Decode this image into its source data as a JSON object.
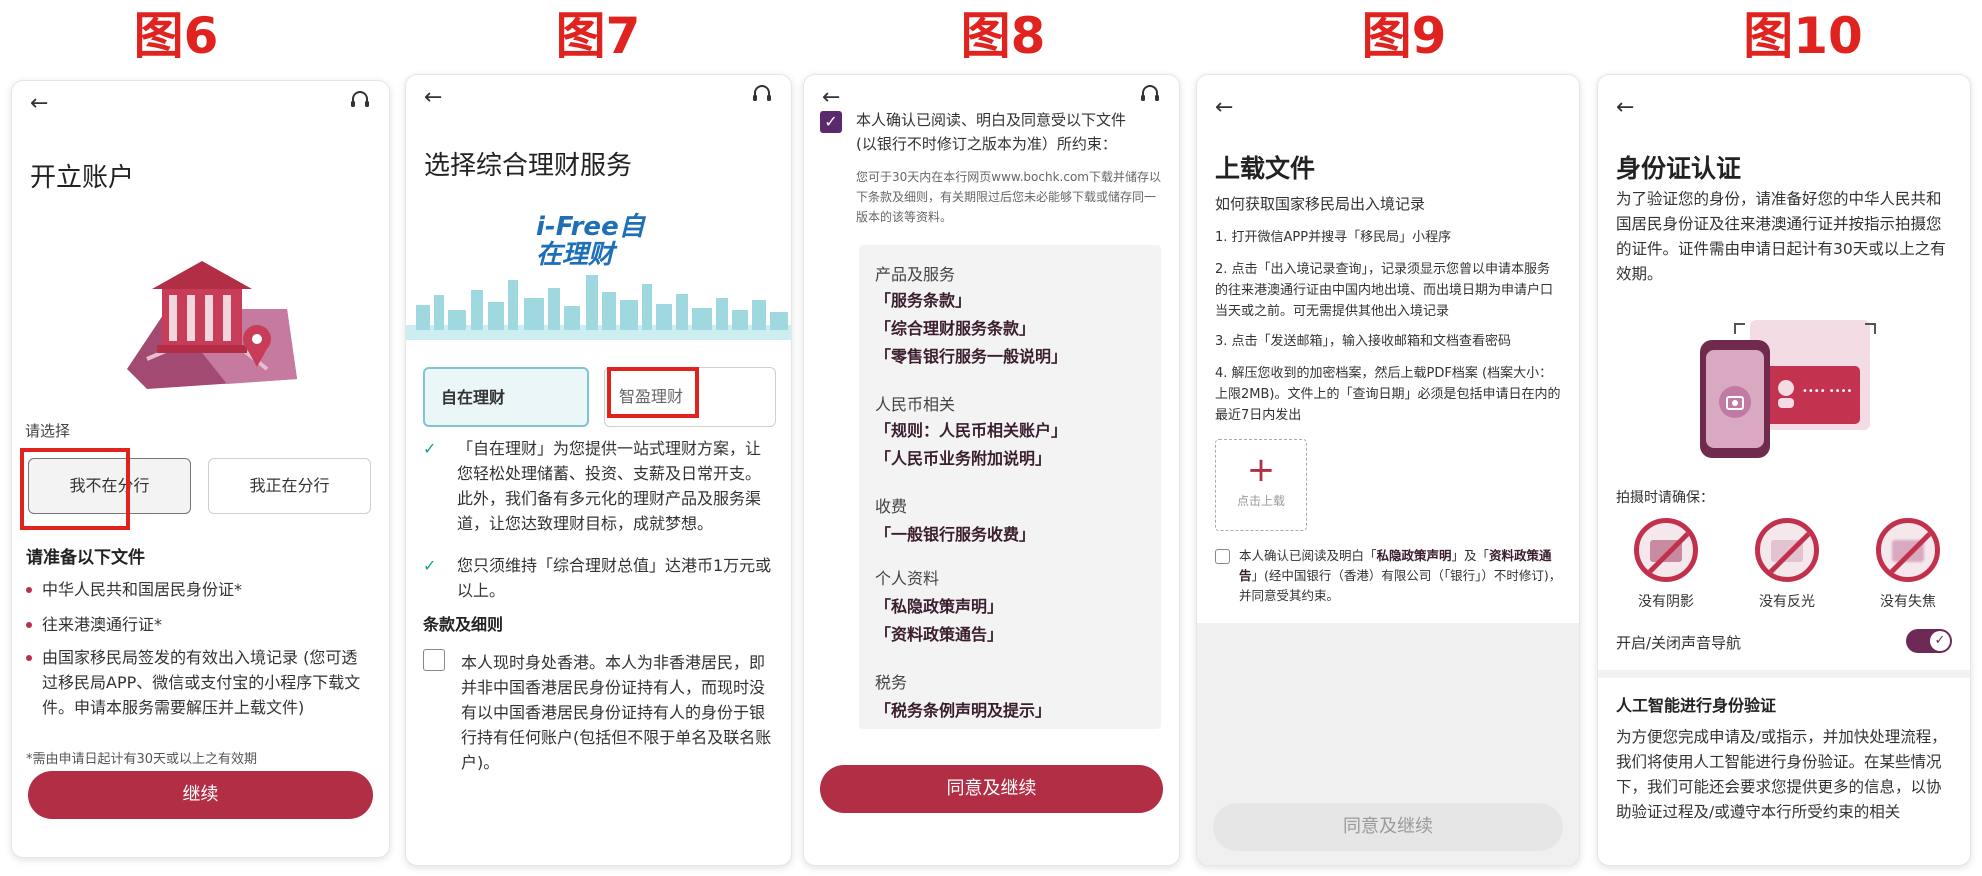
{
  "figures": [
    {
      "label": "图6"
    },
    {
      "label": "图7"
    },
    {
      "label": "图8"
    },
    {
      "label": "图9"
    },
    {
      "label": "图10"
    }
  ],
  "icons": {
    "back": "back-arrow-icon",
    "support": "headset-icon"
  },
  "screen6": {
    "title": "开立账户",
    "choose_label": "请选择",
    "option_not_in_branch": "我不在分行",
    "option_in_branch": "我正在分行",
    "prepare_title": "请准备以下文件",
    "docs": [
      "中华人民共和国居民身份证*",
      "往来港澳通行证*",
      "由国家移民局签发的有效出入境记录 (您可透过移民局APP、微信或支付宝的小程序下载文件。申请本服务需要解压并上载文件)"
    ],
    "footnote": "*需由申请日起计有30天或以上之有效期",
    "continue": "继续"
  },
  "screen7": {
    "title": "选择综合理财服务",
    "logo_text": "i-Free自在理财",
    "tab_free": "自在理财",
    "tab_smart": "智盈理财",
    "point1": "「自在理财」为您提供一站式理财方案，让您轻松处理储蓄、投资、支薪及日常开支。此外，我们备有多元化的理财产品及服务渠道，让您达致理财目标，成就梦想。",
    "point2": "您只须维持「综合理财总值」达港币1万元或以上。",
    "terms_title": "条款及细则",
    "declaration": "本人现时身处香港。本人为非香港居民，即并非中国香港居民身份证持有人，而现时没有以中国香港居民身份证持有人的身份于银行持有任何账户(包括但不限于单名及联名账户)。"
  },
  "screen8": {
    "confirm_line1": "本人确认已阅读、明白及同意受以下文件",
    "confirm_line2": "(以银行不时修订之版本为准）所约束：",
    "note": "您可于30天内在本行网页www.bochk.com下载并储存以下条款及细则，有关期限过后您未必能够下载或储存同一版本的该等资料。",
    "groups": [
      {
        "name": "产品及服务",
        "links": [
          "「服务条款」",
          "「综合理财服务条款」",
          "「零售银行服务一般说明」"
        ]
      },
      {
        "name": "人民币相关",
        "links": [
          "「规则：人民币相关账户」",
          "「人民币业务附加说明」"
        ]
      },
      {
        "name": "收费",
        "links": [
          "「一般银行服务收费」"
        ]
      },
      {
        "name": "个人资料",
        "links": [
          "「私隐政策声明」",
          "「资料政策通告」"
        ]
      },
      {
        "name": "税务",
        "links": [
          "「税务条例声明及提示」"
        ]
      }
    ],
    "agree": "同意及继续"
  },
  "screen9": {
    "title": "上载文件",
    "subtitle": "如何获取国家移民局出入境记录",
    "steps": [
      "1. 打开微信APP并搜寻「移民局」小程序",
      "2. 点击「出入境记录查询」，记录须显示您曾以申请本服务的往来港澳通行证由中国内地出境、而出境日期为申请户口当天或之前。可无需提供其他出入境记录",
      "3. 点击「发送邮箱」，输入接收邮箱和文档查看密码",
      "4. 解压您收到的加密档案，然后上载PDF档案 (档案大小：上限2MB)。文件上的「查询日期」必须是包括申请日在内的最近7日内发出"
    ],
    "upload_plus": "+",
    "upload_label": "点击上载",
    "consent_a": "本人确认已阅读及明白「",
    "consent_link1": "私隐政策声明",
    "consent_b": "」及「",
    "consent_link2": "资料政策通告",
    "consent_c": "」(经中国银行（香港）有限公司（「银行」）不时修订)，并同意受其约束。",
    "agree": "同意及继续"
  },
  "screen10": {
    "title": "身份证认证",
    "intro": "为了验证您的身份，请准备好您的中华人民共和国居民身份证及往来港澳通行证并按指示拍摄您的证件。证件需由申请日起计有30天或以上之有效期。",
    "ensure": "拍摄时请确保：",
    "rules": [
      "没有阴影",
      "没有反光",
      "没有失焦"
    ],
    "card_digits": "•••• ••••",
    "voice_toggle": "开启/关闭声音导航",
    "ai_title": "人工智能进行身份验证",
    "ai_text": "为方便您完成申请及/或指示，并加快处理流程，我们将使用人工智能进行身份验证。在某些情况下，我们可能还会要求您提供更多的信息，以协助验证过程及/或遵守本行所受约束的相关"
  },
  "colors": {
    "brand": "#b12e45",
    "highlight": "#e0231f",
    "tick": "#1a9e8f"
  }
}
